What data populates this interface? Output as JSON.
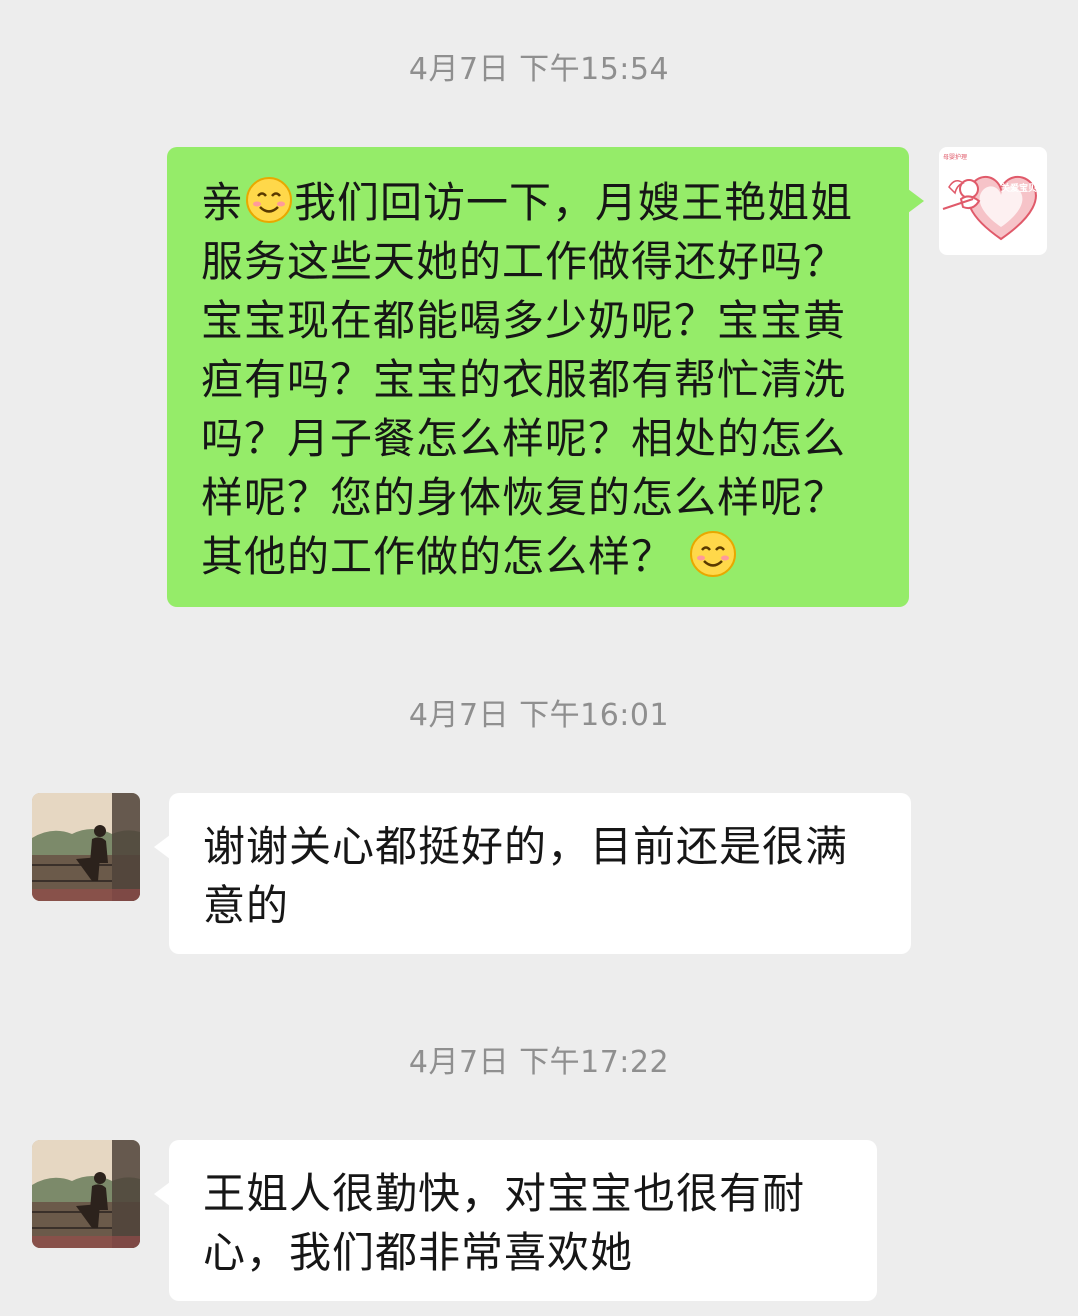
{
  "messages": [
    {
      "time": "4月7日 下午15:54",
      "sender": "self",
      "text_segments": [
        "亲",
        "我们回访一下，月嫂王艳姐姐服务这些天她的工作做得还好吗？宝宝现在都能喝多少奶呢？宝宝黄疸有吗？宝宝的衣服都有帮忙清洗吗？月子餐怎么样呢？相处的怎么样呢？您的身体恢复的怎么样呢？其他的工作做的怎么样？"
      ]
    },
    {
      "time": "4月7日 下午16:01",
      "sender": "contact",
      "text": "谢谢关心都挺好的，目前还是很满意的"
    },
    {
      "time": "4月7日 下午17:22",
      "sender": "contact",
      "text": "王姐人很勤快，对宝宝也很有耐心，我们都非常喜欢她"
    }
  ],
  "self_avatar": {
    "icon": "cupid-heart-logo-icon",
    "small_text": "母婴护理",
    "heart_text": "关爱宝贝",
    "color": "#e05a6a"
  },
  "contact_avatar": {
    "icon": "woman-on-balcony-photo"
  },
  "colors": {
    "outgoing_bubble": "#95ec69",
    "incoming_bubble": "#ffffff",
    "background": "#ededed",
    "timestamp": "#8f8f8f"
  }
}
